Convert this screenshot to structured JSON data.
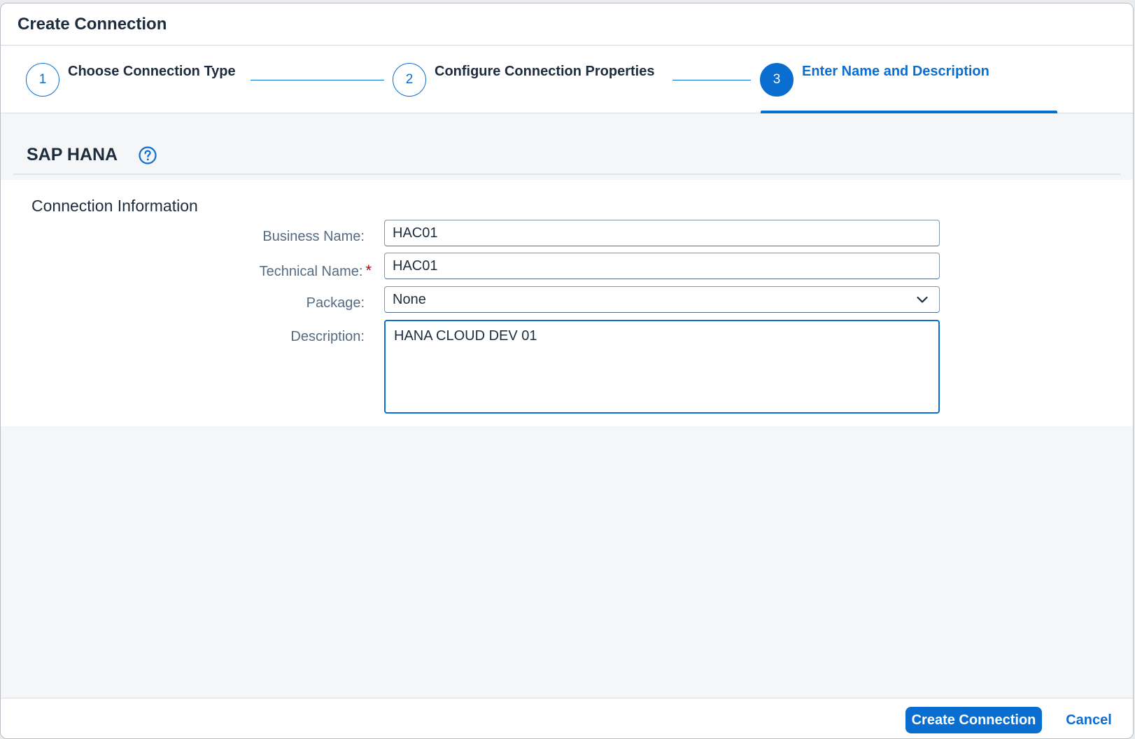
{
  "dialog": {
    "title": "Create Connection"
  },
  "wizard": {
    "steps": [
      {
        "number": "1",
        "label": "Choose Connection Type",
        "state": "completed"
      },
      {
        "number": "2",
        "label": "Configure Connection Properties",
        "state": "completed"
      },
      {
        "number": "3",
        "label": "Enter Name and Description",
        "state": "active"
      }
    ]
  },
  "section": {
    "title": "SAP HANA",
    "help_icon": "help-circle-icon"
  },
  "form": {
    "heading": "Connection Information",
    "business_name": {
      "label": "Business Name:",
      "value": "HAC01"
    },
    "technical_name": {
      "label": "Technical Name:",
      "required_mark": "*",
      "value": "HAC01"
    },
    "package": {
      "label": "Package:",
      "value": "None",
      "icon": "chevron-down-icon"
    },
    "description": {
      "label": "Description:",
      "value": "HANA CLOUD DEV 01"
    }
  },
  "footer": {
    "primary_label": "Create Connection",
    "cancel_label": "Cancel"
  },
  "colors": {
    "accent": "#0a6ed1",
    "required": "#aa0808",
    "label": "#556b82",
    "text": "#1d2d3e"
  }
}
